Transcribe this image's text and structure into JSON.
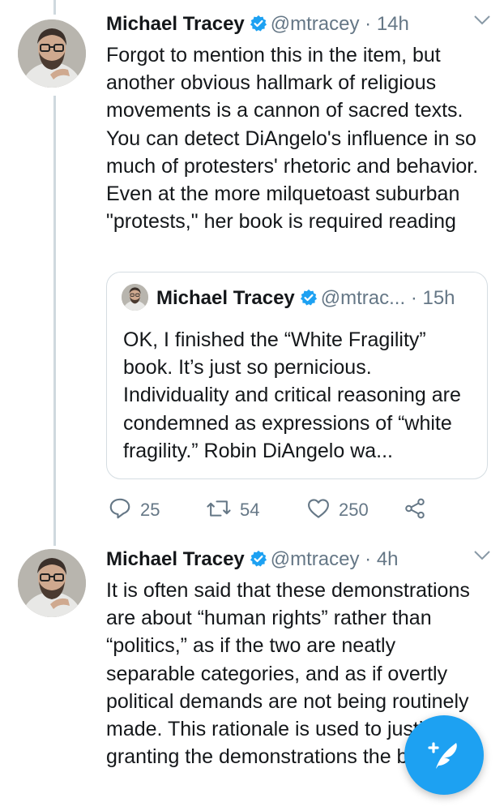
{
  "tweets": [
    {
      "display_name": "Michael Tracey",
      "handle": "@mtracey",
      "separator": "·",
      "time": "14h",
      "text": "Forgot to mention this in the item, but another obvious hallmark of religious movements is a cannon of sacred texts. You can detect DiAngelo's influence in so much of protesters' rhetoric and behavior. Even at the more milquetoast suburban \"protests,\" her book is required reading",
      "quoted": {
        "display_name": "Michael Tracey",
        "handle": "@mtrac...",
        "separator": "·",
        "time": "15h",
        "text": "OK, I finished the “White Fragility” book. It’s just so pernicious. Individuality and critical reasoning are condemned as expressions of “white fragility.” Robin DiAngelo wa..."
      },
      "actions": {
        "replies": "25",
        "retweets": "54",
        "likes": "250"
      }
    },
    {
      "display_name": "Michael Tracey",
      "handle": "@mtracey",
      "separator": "·",
      "time": "4h",
      "text": "It is often said that these demonstrations are about “human rights” rather than “politics,” as if the two are neatly separable categories, and as if overtly political demands are not being routinely made. This rationale is used to justify granting the demonstrations the backing"
    }
  ],
  "icons": {
    "verified": "verified-badge-icon",
    "menu": "chevron-down-icon",
    "reply": "reply-icon",
    "retweet": "retweet-icon",
    "like": "heart-icon",
    "share": "share-icon",
    "compose": "compose-tweet-icon"
  },
  "colors": {
    "accent": "#1da1f2",
    "secondary_text": "#657786",
    "primary_text": "#14171a"
  }
}
